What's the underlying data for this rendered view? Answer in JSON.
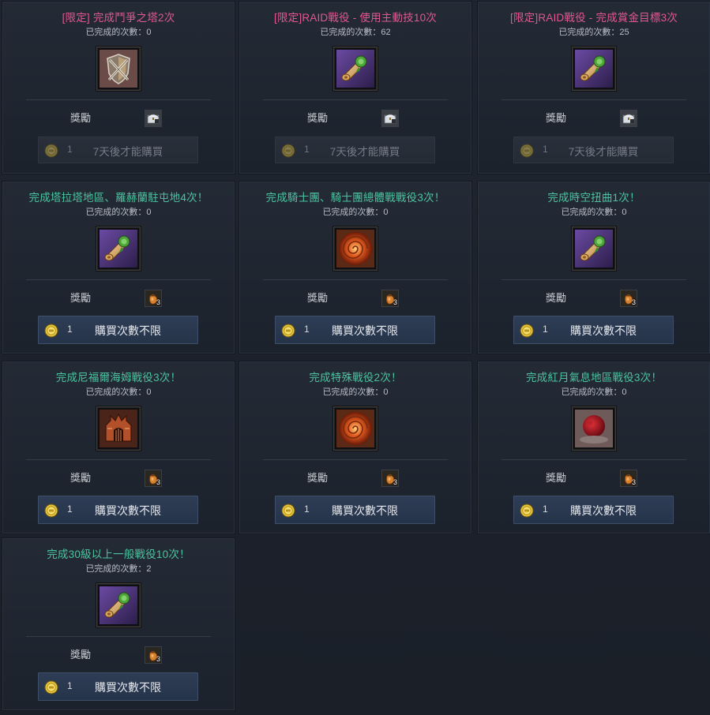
{
  "labels": {
    "completed_prefix": "已完成的次數：",
    "reward": "獎勵"
  },
  "colors": {
    "limited_title": "#e0588f",
    "normal_title": "#4cc3a0",
    "button_active": "#2e3d55",
    "button_disabled": "#2a303b"
  },
  "missions": [
    {
      "title": "[限定] 完成鬥爭之塔2次",
      "title_style": "limited",
      "count": "已完成的次數：0",
      "icon": "shield-crossed-swords-icon",
      "reward_icon": "silver-chest-icon",
      "reward_qty": "",
      "price": "1",
      "button_text": "7天後才能購買",
      "button_state": "disabled"
    },
    {
      "title": "[限定]RAID戰役 - 使用主動技10次",
      "title_style": "limited",
      "count": "已完成的次數：62",
      "icon": "scroll-icon",
      "reward_icon": "silver-chest-icon",
      "reward_qty": "",
      "price": "1",
      "button_text": "7天後才能購買",
      "button_state": "disabled"
    },
    {
      "title": "[限定]RAID戰役 - 完成賞金目標3次",
      "title_style": "limited",
      "count": "已完成的次數：25",
      "icon": "scroll-icon",
      "reward_icon": "silver-chest-icon",
      "reward_qty": "",
      "price": "1",
      "button_text": "7天後才能購買",
      "button_state": "disabled"
    },
    {
      "title": "完成塔拉塔地區、羅赫蘭駐屯地4次！",
      "title_style": "normal",
      "count": "已完成的次數：0",
      "icon": "scroll-icon",
      "reward_icon": "pouch-icon",
      "reward_qty": "3",
      "price": "1",
      "button_text": "購買次數不限",
      "button_state": "active"
    },
    {
      "title": "完成騎士團、騎士團總體戰戰役3次！",
      "title_style": "normal",
      "count": "已完成的次數：0",
      "icon": "fire-swirl-icon",
      "reward_icon": "pouch-icon",
      "reward_qty": "3",
      "price": "1",
      "button_text": "購買次數不限",
      "button_state": "active"
    },
    {
      "title": "完成時空扭曲1次！",
      "title_style": "normal",
      "count": "已完成的次數：0",
      "icon": "scroll-icon",
      "reward_icon": "pouch-icon",
      "reward_qty": "3",
      "price": "1",
      "button_text": "購買次數不限",
      "button_state": "active"
    },
    {
      "title": "完成尼福爾海姆戰役3次！",
      "title_style": "normal",
      "count": "已完成的次數：0",
      "icon": "fortress-icon",
      "reward_icon": "pouch-icon",
      "reward_qty": "3",
      "price": "1",
      "button_text": "購買次數不限",
      "button_state": "active"
    },
    {
      "title": "完成特殊戰役2次！",
      "title_style": "normal",
      "count": "已完成的次數：0",
      "icon": "fire-swirl-icon",
      "reward_icon": "pouch-icon",
      "reward_qty": "3",
      "price": "1",
      "button_text": "購買次數不限",
      "button_state": "active"
    },
    {
      "title": "完成紅月氣息地區戰役3次！",
      "title_style": "normal",
      "count": "已完成的次數：0",
      "icon": "red-moon-icon",
      "reward_icon": "pouch-icon",
      "reward_qty": "3",
      "price": "1",
      "button_text": "購買次數不限",
      "button_state": "active"
    },
    {
      "title": "完成30級以上一般戰役10次！",
      "title_style": "normal",
      "count": "已完成的次數：2",
      "icon": "scroll-icon",
      "reward_icon": "pouch-icon",
      "reward_qty": "3",
      "price": "1",
      "button_text": "購買次數不限",
      "button_state": "active"
    }
  ]
}
